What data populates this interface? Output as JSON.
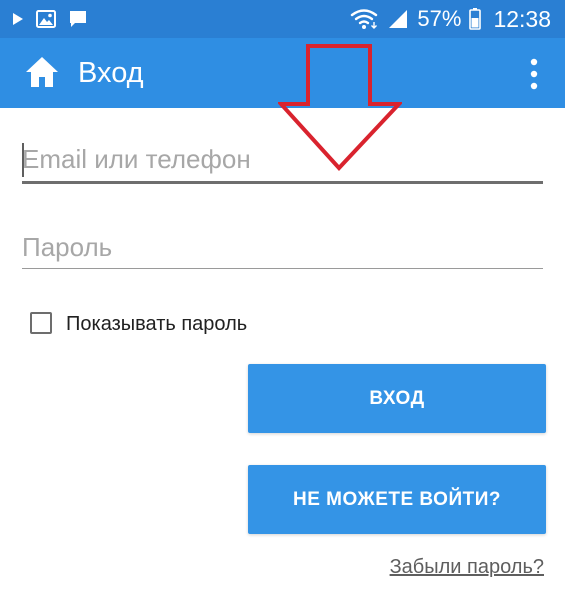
{
  "status_bar": {
    "battery": "57%",
    "time": "12:38",
    "icons": [
      "play-icon",
      "image-icon",
      "message-icon",
      "wifi-icon",
      "signal-icon",
      "battery-icon"
    ]
  },
  "toolbar": {
    "title": "Вход",
    "home_icon": "home-icon",
    "menu_icon": "more-vert-icon"
  },
  "form": {
    "email_placeholder": "Email или телефон",
    "password_placeholder": "Пароль",
    "show_password_label": "Показывать пароль",
    "show_password_checked": false,
    "login_button": "ВХОД",
    "cant_login_button": "НЕ МОЖЕТЕ ВОЙТИ?",
    "forgot_link": "Забыли пароль?"
  },
  "colors": {
    "status_bar": "#2a7fd3",
    "toolbar": "#2f8ee3",
    "button": "#3494e6",
    "annotation_arrow": "#d9232e"
  }
}
